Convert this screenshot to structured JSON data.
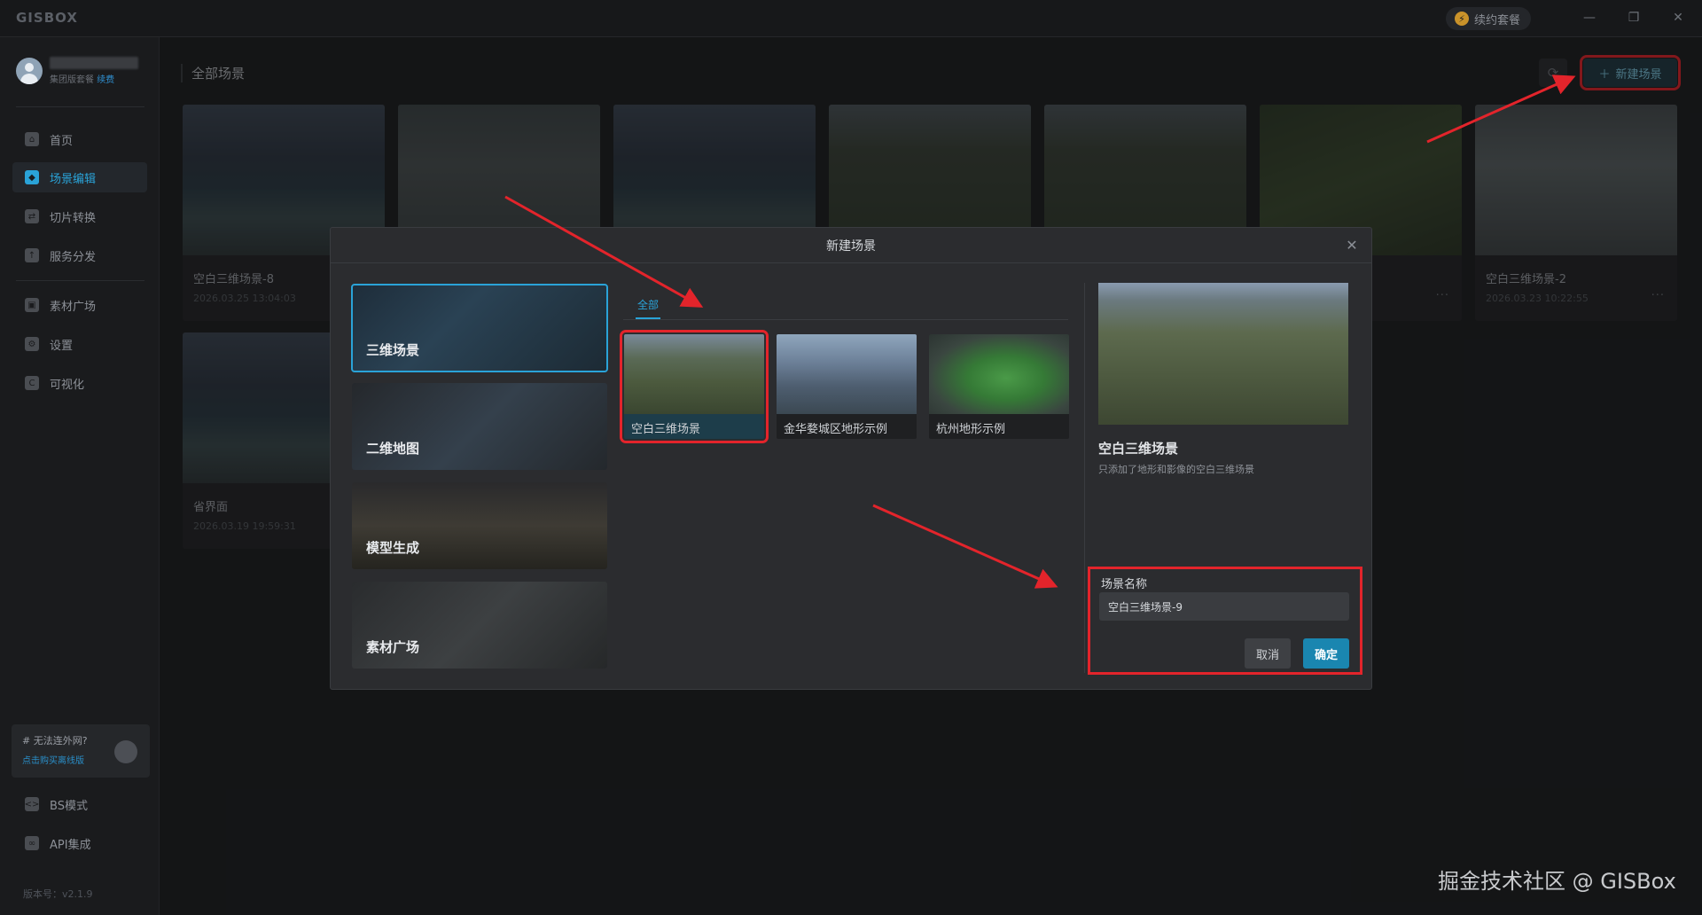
{
  "app": {
    "logo": "GISBOX",
    "renew_label": "续约套餐"
  },
  "window_controls": {
    "minimize": "—",
    "restore": "❐",
    "close": "✕"
  },
  "user": {
    "plan": "集团版套餐",
    "renew_link": "续费"
  },
  "nav": {
    "items": [
      {
        "label": "首页",
        "icon": "home-icon"
      },
      {
        "label": "场景编辑",
        "icon": "cube-icon",
        "active": true
      },
      {
        "label": "切片转换",
        "icon": "convert-icon"
      },
      {
        "label": "服务分发",
        "icon": "upload-icon"
      },
      {
        "label": "素材广场",
        "icon": "image-icon"
      },
      {
        "label": "设置",
        "icon": "gear-icon"
      },
      {
        "label": "可视化",
        "icon": "chart-icon"
      }
    ],
    "bottom_items": [
      {
        "label": "BS模式",
        "icon": "code-icon"
      },
      {
        "label": "API集成",
        "icon": "link-icon"
      }
    ]
  },
  "offline": {
    "title": "# 无法连外网?",
    "link": "点击购买离线版"
  },
  "version": "版本号：v2.1.9",
  "main": {
    "title": "全部场景",
    "new_button": "新建场景",
    "cards": [
      {
        "name": "空白三维场景-8",
        "date": "2026.03.25 13:04:03"
      },
      {
        "name": "空白三维场景-2",
        "date": "2026.03.23 10:22:55"
      },
      {
        "name": "省界面",
        "date": "2026.03.19 19:59:31"
      }
    ],
    "more": "···"
  },
  "modal": {
    "title": "新建场景",
    "close": "✕",
    "categories": [
      "三维场景",
      "二维地图",
      "模型生成",
      "素材广场"
    ],
    "tab": "全部",
    "templates": [
      "空白三维场景",
      "金华婺城区地形示例",
      "杭州地形示例"
    ],
    "preview_title": "空白三维场景",
    "preview_desc": "只添加了地形和影像的空白三维场景",
    "name_label": "场景名称",
    "name_value": "空白三维场景-9",
    "cancel": "取消",
    "confirm": "确定"
  },
  "watermark": "掘金技术社区 @ GISBox",
  "colors": {
    "accent": "#2aa3d8",
    "highlight": "#e3242b",
    "primary_button": "#1a86b0"
  }
}
